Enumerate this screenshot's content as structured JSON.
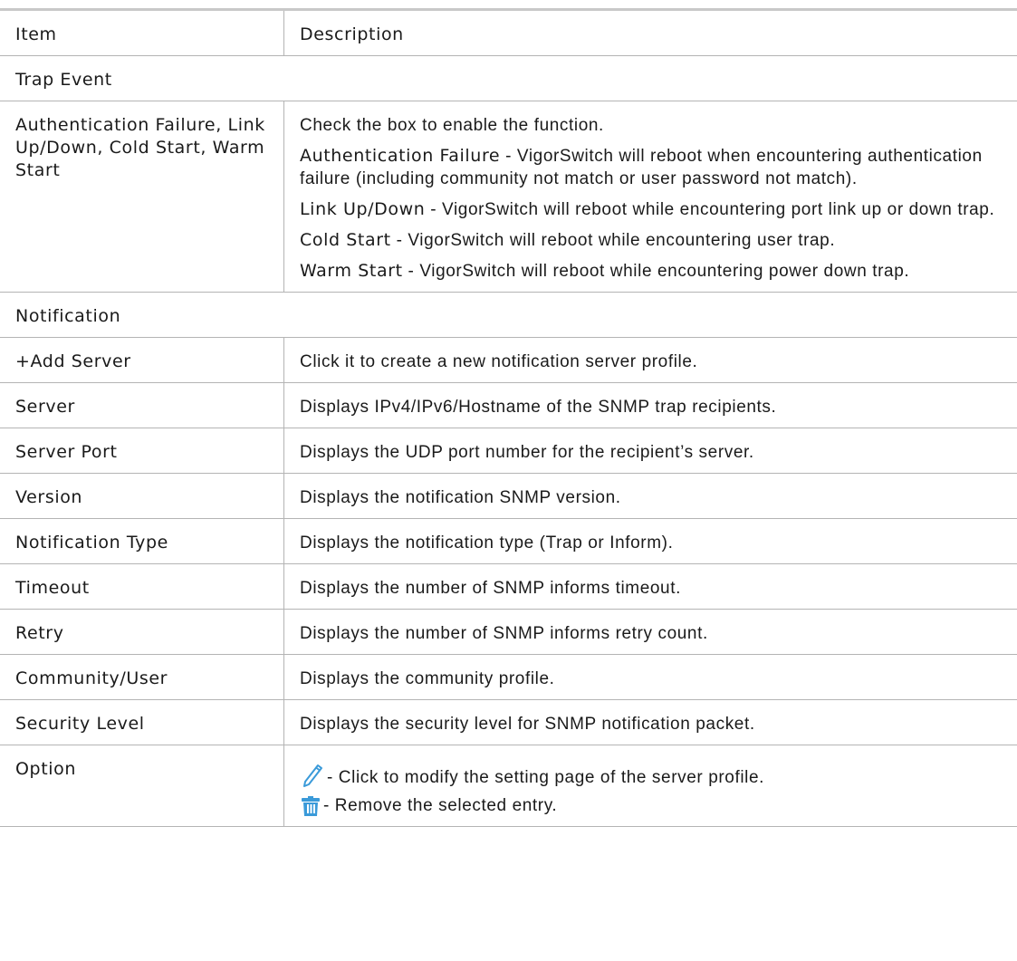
{
  "header": {
    "item": "Item",
    "description": "Description"
  },
  "trap_event": {
    "section_title": "Trap Event",
    "item_label": "Authentication Failure, Link Up/Down, Cold Start, Warm Start",
    "intro": "Check the box to enable the function.",
    "entries": [
      {
        "term": "Authentication Failure",
        "text": " - VigorSwitch will reboot when encountering authentication failure (including community not match or user password not match)."
      },
      {
        "term": "Link Up/Down",
        "text": " - VigorSwitch will reboot while encountering port link up or down trap."
      },
      {
        "term": "Cold Start",
        "text": " - VigorSwitch will reboot while encountering user trap."
      },
      {
        "term": "Warm Start",
        "text": " - VigorSwitch will reboot while encountering power down trap."
      }
    ]
  },
  "notification": {
    "section_title": "Notification",
    "rows": [
      {
        "item": "+Add Server",
        "description": "Click it to create a new notification server profile."
      },
      {
        "item": "Server",
        "description": "Displays IPv4/IPv6/Hostname of the SNMP trap recipients."
      },
      {
        "item": "Server Port",
        "description": "Displays the UDP port number for the recipient’s server."
      },
      {
        "item": "Version",
        "description": "Displays the notification SNMP version."
      },
      {
        "item": "Notification Type",
        "description": "Displays the notification type (Trap or Inform)."
      },
      {
        "item": "Timeout",
        "description": "Displays the number of SNMP informs timeout."
      },
      {
        "item": "Retry",
        "description": "Displays the number of SNMP informs retry count."
      },
      {
        "item": "Community/User",
        "description": "Displays the community profile."
      },
      {
        "item": "Security Level",
        "description": "Displays the security level for SNMP notification packet."
      }
    ],
    "option": {
      "item": "Option",
      "edit_text": " - Click to modify the setting page of the server profile.",
      "edit_icon": "pencil-icon",
      "delete_text": " - Remove the selected entry.",
      "delete_icon": "trash-icon",
      "icon_color": "#3a9ad9"
    }
  }
}
